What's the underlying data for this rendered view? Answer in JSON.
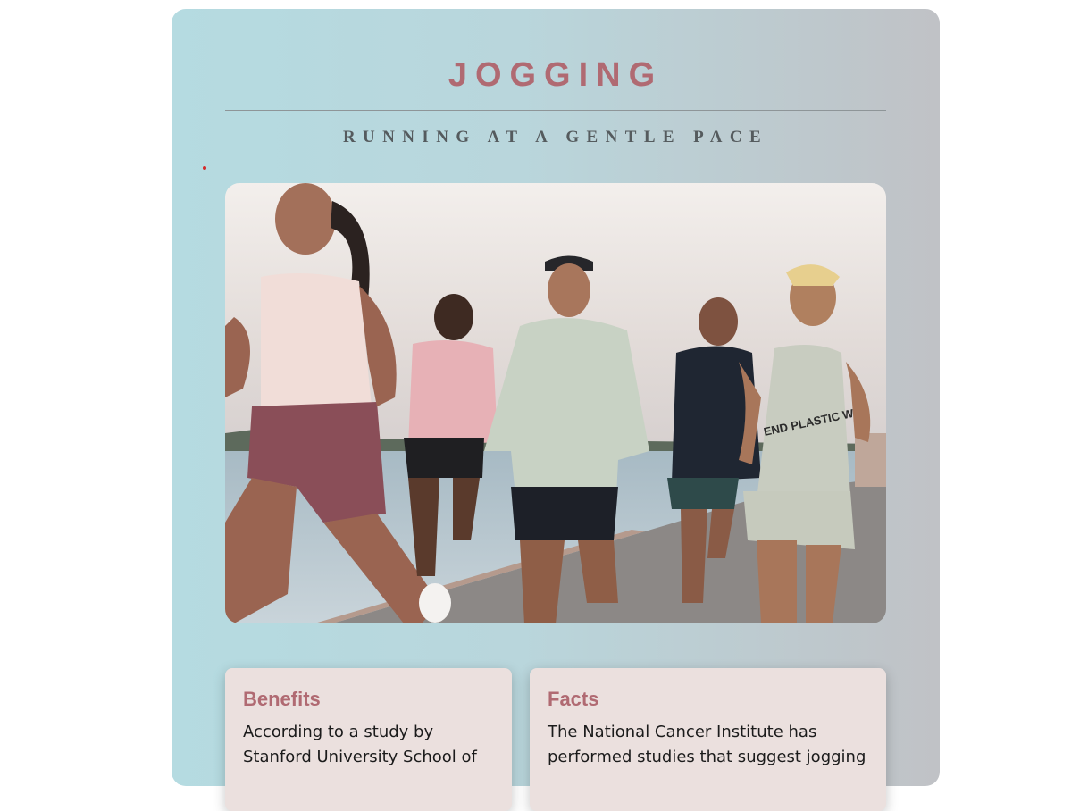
{
  "header": {
    "title": "JOGGING",
    "subtitle": "RUNNING AT A GENTLE PACE"
  },
  "hero": {
    "image_alt": "Group of five runners jogging along a waterfront path",
    "shirt_print": "END PLASTIC W"
  },
  "cards": {
    "benefits": {
      "heading": "Benefits",
      "text": "According to a study by Stanford University School of"
    },
    "facts": {
      "heading": "Facts",
      "text": "The National Cancer Institute has performed studies that suggest jogging"
    }
  },
  "colors": {
    "title": "#b06a72",
    "subtitle": "#555b5e",
    "card_background": "#ebe0de",
    "accent_dot": "#d42a2a"
  }
}
